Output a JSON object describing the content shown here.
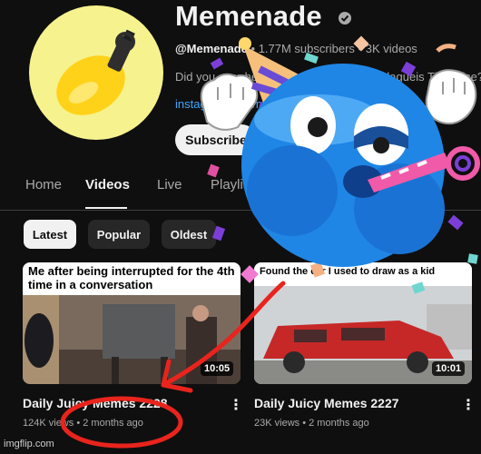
{
  "channel": {
    "name": "Memenade",
    "handle": "@Memenade",
    "subscribers": "1.77M subscribers",
    "videos_count": "3K videos",
    "description": "Did you ever hear the tragedy of Darth Plagueis The Wise?",
    "link": "instagram.com/memenade",
    "subscribe_label": "Subscribe",
    "verified_icon": "verified-check-icon"
  },
  "tabs": [
    {
      "label": "Home"
    },
    {
      "label": "Videos",
      "active": true
    },
    {
      "label": "Live"
    },
    {
      "label": "Playlists"
    }
  ],
  "filters": [
    {
      "label": "Latest",
      "selected": true
    },
    {
      "label": "Popular"
    },
    {
      "label": "Oldest"
    }
  ],
  "videos": [
    {
      "thumb_caption": "Me after being interrupted for the 4th time in a conversation",
      "duration": "10:05",
      "title": "Daily Juicy Memes 2228",
      "views": "124K views",
      "age": "2 months ago"
    },
    {
      "thumb_caption": "Found the car I used to draw as a kid",
      "duration": "10:01",
      "title": "Daily Juicy Memes 2227",
      "views": "23K views",
      "age": "2 months ago"
    }
  ],
  "meta_separator": "•",
  "watermark": "imgflip.com",
  "colors": {
    "background": "#0f0f0f",
    "link": "#3ea6ff",
    "avatar_bg": "#f6f28e",
    "annotation_red": "#e8241d",
    "emoji_blue": "#1f86e6"
  }
}
